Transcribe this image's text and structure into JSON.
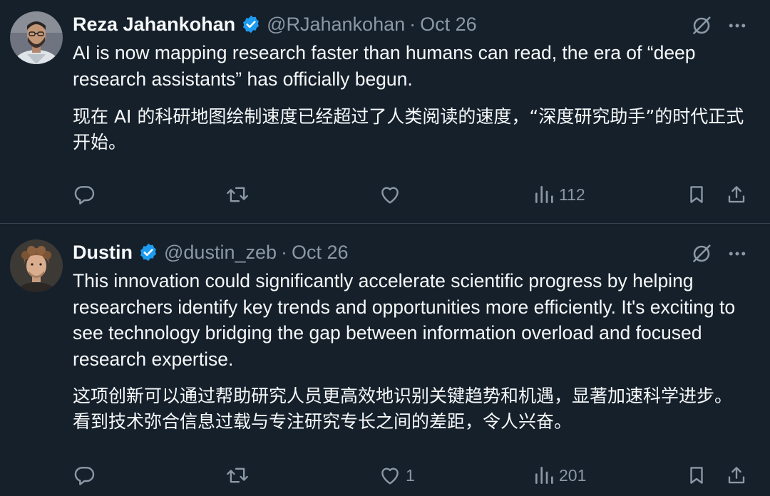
{
  "colors": {
    "background": "#15202b",
    "text_primary": "#f7f9f9",
    "text_secondary": "#8b98a5",
    "verified_badge": "#1d9bf0",
    "divider": "#38444d"
  },
  "tweets": [
    {
      "author": {
        "name": "Reza Jahankohan",
        "handle": "@RJahankohan",
        "verified": true,
        "avatar_icon": "avatar-photo"
      },
      "date": "Oct 26",
      "separator": "·",
      "text": "AI is now mapping research faster than humans can read, the era of “deep research assistants” has officially begun.",
      "translation": "现在 AI 的科研地图绘制速度已经超过了人类阅读的速度，“深度研究助手”的时代正式开始。",
      "actions": {
        "reply_count": "",
        "retweet_count": "",
        "like_count": "",
        "views_count": "112"
      }
    },
    {
      "author": {
        "name": "Dustin",
        "handle": "@dustin_zeb",
        "verified": true,
        "avatar_icon": "avatar-photo"
      },
      "date": "Oct 26",
      "separator": "·",
      "text": "This innovation could significantly accelerate scientific progress by helping researchers identify key trends and opportunities more efficiently. It's exciting to see technology bridging the gap between information overload and focused research expertise.",
      "translation": "这项创新可以通过帮助研究人员更高效地识别关键趋势和机遇，显著加速科学进步。看到技术弥合信息过载与专注研究专长之间的差距，令人兴奋。",
      "actions": {
        "reply_count": "",
        "retweet_count": "",
        "like_count": "1",
        "views_count": "201"
      }
    }
  ]
}
